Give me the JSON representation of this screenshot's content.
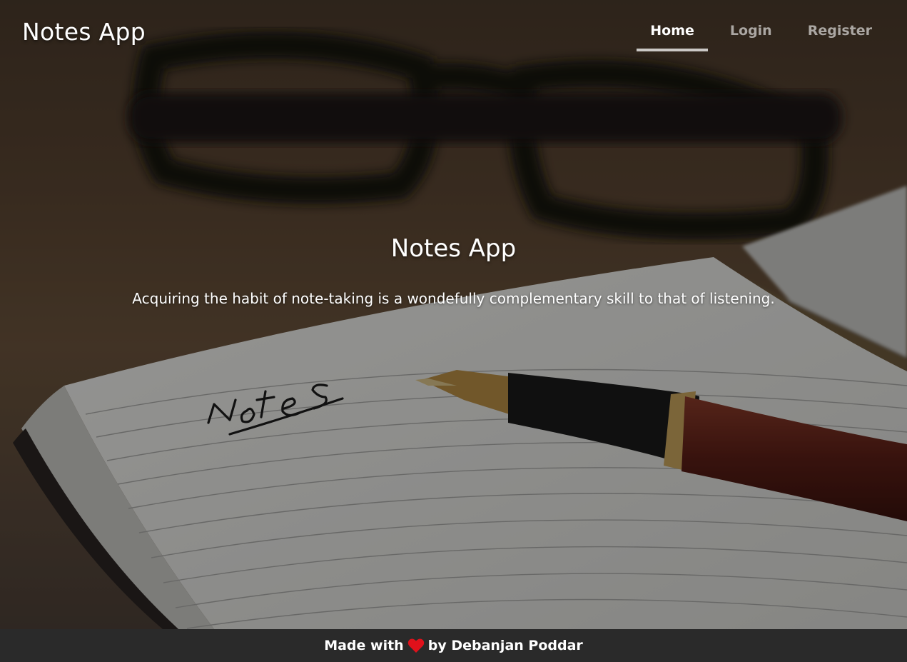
{
  "header": {
    "brand": "Notes App",
    "nav": [
      {
        "label": "Home",
        "active": true
      },
      {
        "label": "Login",
        "active": false
      },
      {
        "label": "Register",
        "active": false
      }
    ]
  },
  "hero": {
    "title": "Notes App",
    "lead": "Acquiring the habit of note-taking is a wondefully complementary skill to that of listening.",
    "notebook_text": "Notes"
  },
  "footer": {
    "prefix": "Made with",
    "icon": "heart-icon",
    "suffix": "by Debanjan Poddar"
  },
  "colors": {
    "footer_bg": "#2a2a2a",
    "heart": "#e0111b",
    "text": "#ffffff"
  }
}
